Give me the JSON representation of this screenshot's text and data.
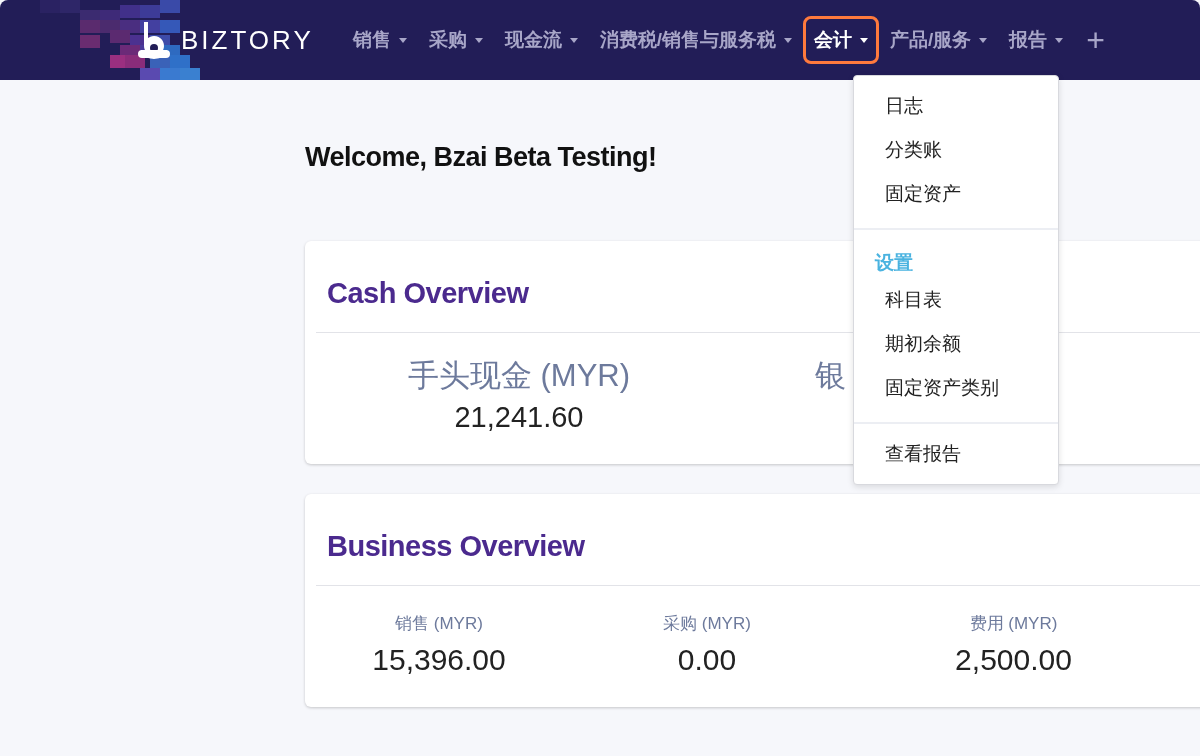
{
  "brand": "BIZTORY",
  "nav": [
    {
      "label": "销售",
      "selected": false
    },
    {
      "label": "采购",
      "selected": false
    },
    {
      "label": "现金流",
      "selected": false
    },
    {
      "label": "消费税/销售与服务税",
      "selected": false
    },
    {
      "label": "会计",
      "selected": true
    },
    {
      "label": "产品/服务",
      "selected": false
    },
    {
      "label": "报告",
      "selected": false
    }
  ],
  "add_button": "+",
  "welcome": "Welcome, Bzai Beta Testing!",
  "cash_overview": {
    "title": "Cash Overview",
    "stats": [
      {
        "label": "手头现金 (MYR)",
        "value": "21,241.60"
      },
      {
        "label": "银"
      }
    ]
  },
  "business_overview": {
    "title": "Business Overview",
    "stats": [
      {
        "label": "销售 (MYR)",
        "value": "15,396.00"
      },
      {
        "label": "采购 (MYR)",
        "value": "0.00"
      },
      {
        "label": "费用 (MYR)",
        "value": "2,500.00"
      }
    ]
  },
  "menu": [
    {
      "kind": "item",
      "label": "日志"
    },
    {
      "kind": "item",
      "label": "分类账"
    },
    {
      "kind": "item",
      "label": "固定资产"
    },
    {
      "kind": "divider"
    },
    {
      "kind": "header",
      "label": "设置"
    },
    {
      "kind": "item",
      "label": "科目表"
    },
    {
      "kind": "item",
      "label": "期初余额"
    },
    {
      "kind": "item",
      "label": "固定资产类别"
    },
    {
      "kind": "divider"
    },
    {
      "kind": "item",
      "label": "查看报告"
    }
  ]
}
